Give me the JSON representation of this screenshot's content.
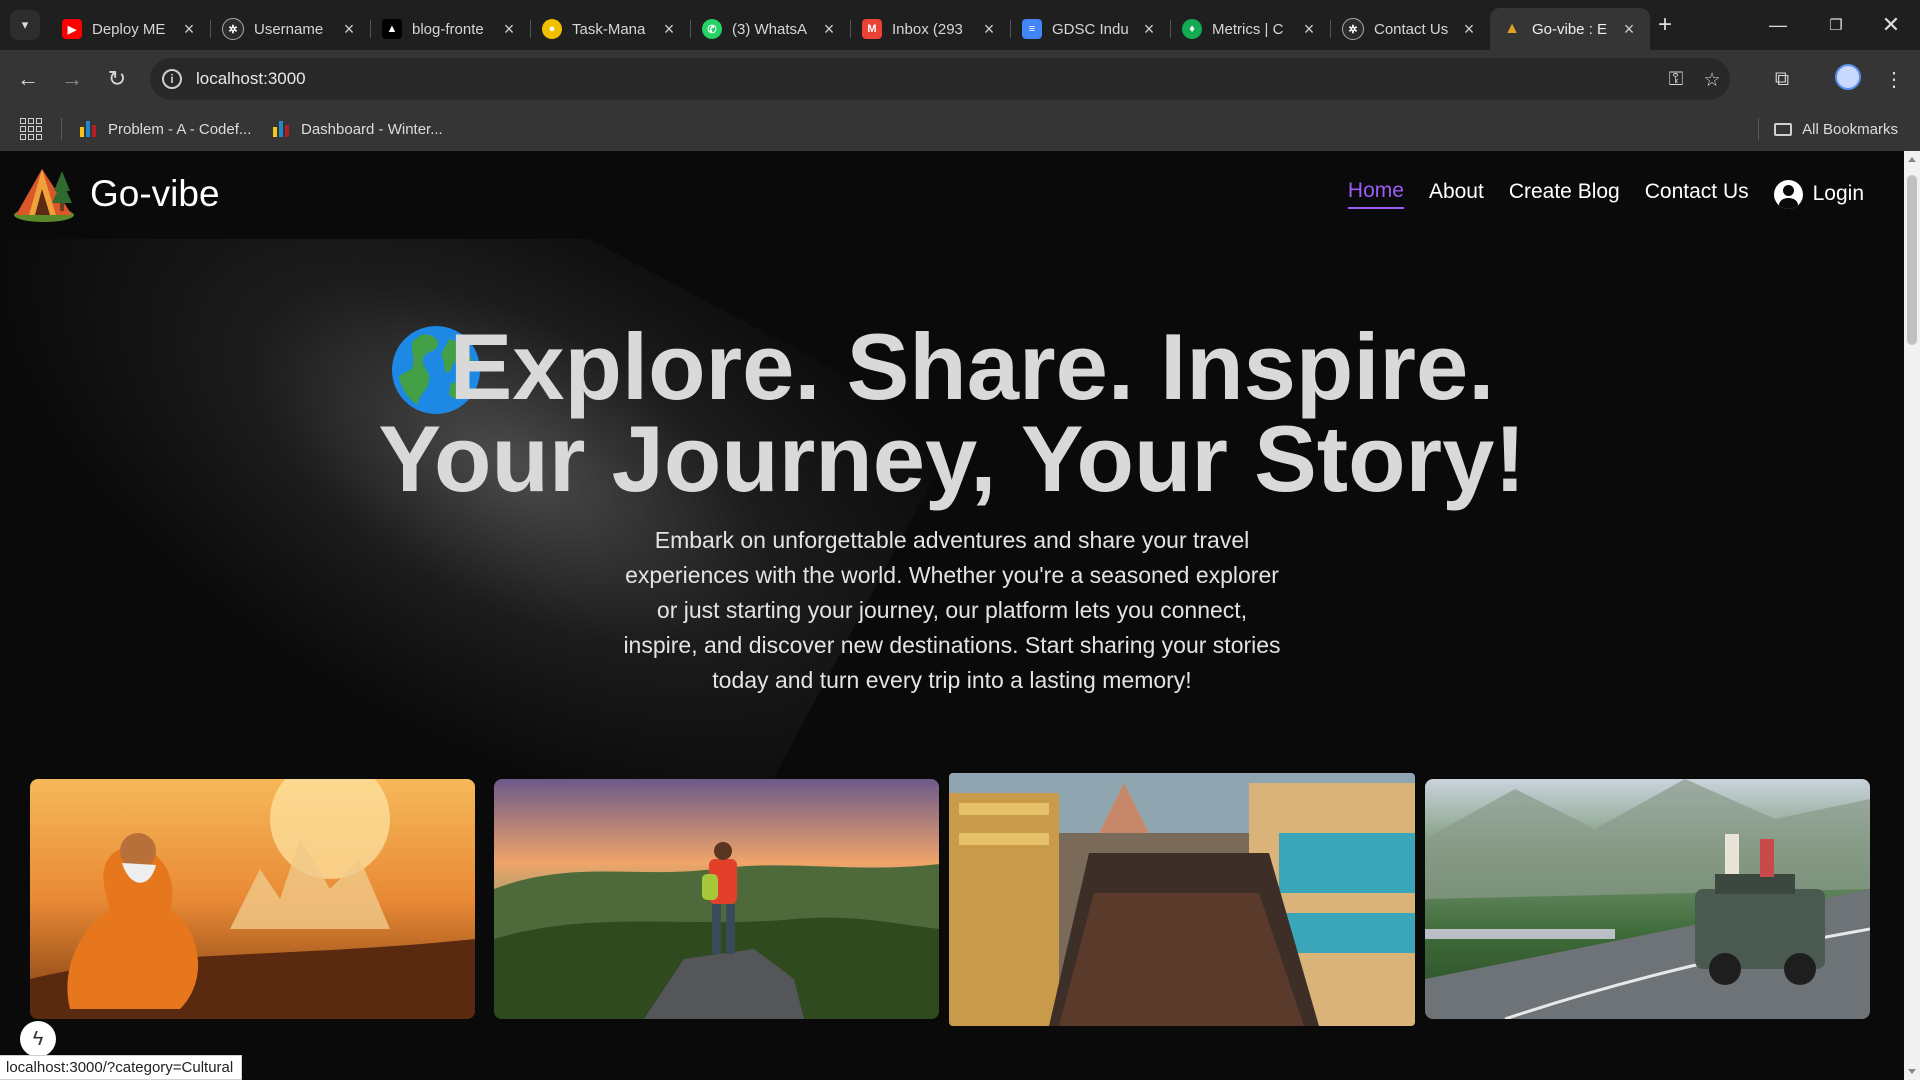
{
  "browser": {
    "tabs": [
      {
        "title": "Deploy ME",
        "favicon": "youtube-icon",
        "color": "#ff0000"
      },
      {
        "title": "Username",
        "favicon": "openai-icon",
        "color": "#444444"
      },
      {
        "title": "blog-fronte",
        "favicon": "vercel-icon",
        "color": "#000000"
      },
      {
        "title": "Task-Mana",
        "favicon": "render-icon",
        "color": "#f0c000"
      },
      {
        "title": "(3) WhatsA",
        "favicon": "whatsapp-icon",
        "color": "#25d366"
      },
      {
        "title": "Inbox (293",
        "favicon": "gmail-icon",
        "color": "#ea4335"
      },
      {
        "title": "GDSC Indu",
        "favicon": "docs-icon",
        "color": "#4285f4"
      },
      {
        "title": "Metrics | C",
        "favicon": "mongodb-icon",
        "color": "#13aa52"
      },
      {
        "title": "Contact Us",
        "favicon": "openai-icon",
        "color": "#444444"
      },
      {
        "title": "Go-vibe : E",
        "favicon": "tent-icon",
        "color": "#e0a020",
        "active": true
      }
    ],
    "url": "localhost:3000",
    "bookmarks": [
      {
        "label": "Problem - A - Codef..."
      },
      {
        "label": "Dashboard - Winter..."
      }
    ],
    "all_bookmarks_label": "All Bookmarks",
    "status_url": "localhost:3000/?category=Cultural"
  },
  "site": {
    "brand": "Go-vibe",
    "nav": {
      "home": "Home",
      "about": "About",
      "create_blog": "Create Blog",
      "contact": "Contact Us",
      "login": "Login"
    },
    "hero": {
      "title_line1": "Explore. Share. Inspire.",
      "title_line2": "Your Journey, Your Story!",
      "text": "Embark on unforgettable adventures and share your travel experiences with the world. Whether you're a seasoned explorer or just starting your journey, our platform lets you connect, inspire, and discover new destinations. Start sharing your stories today and turn every trip into a lasting memory!"
    },
    "accent_color": "#9d5cf5"
  }
}
